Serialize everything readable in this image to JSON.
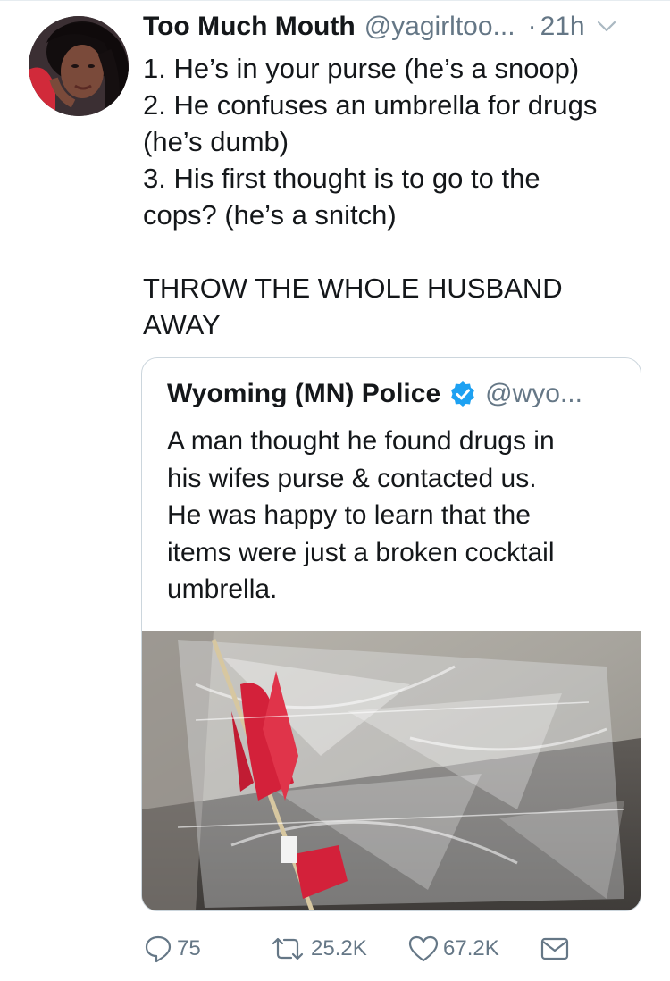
{
  "tweet": {
    "author_name": "Too Much Mouth",
    "author_handle": "@yagirltoo...",
    "separator": "·",
    "time": "21h",
    "lines": [
      "1. He’s in your purse (he’s a snoop)",
      "2. He confuses an umbrella for drugs",
      "(he’s dumb)",
      "3. His first thought is to go to the",
      "cops? (he’s a snitch)",
      "",
      "THROW THE WHOLE HUSBAND",
      "AWAY"
    ]
  },
  "quoted_tweet": {
    "author_name": "Wyoming (MN) Police",
    "author_handle": "@wyo...",
    "verified": true,
    "lines": [
      "A man thought he found drugs in",
      "his wifes purse & contacted us.",
      "He was happy to learn that the",
      "items were just a broken cocktail",
      "umbrella."
    ]
  },
  "actions": {
    "replies": "75",
    "retweets": "25.2K",
    "likes": "67.2K"
  },
  "icons": {
    "reply": "reply-icon",
    "retweet": "retweet-icon",
    "like": "heart-icon",
    "message": "envelope-icon",
    "caret": "chevron-down-icon",
    "verified": "verified-badge-icon"
  },
  "colors": {
    "text": "#14171a",
    "secondary": "#657786",
    "verified_blue": "#1da1f2",
    "border": "#ccd6dd"
  }
}
